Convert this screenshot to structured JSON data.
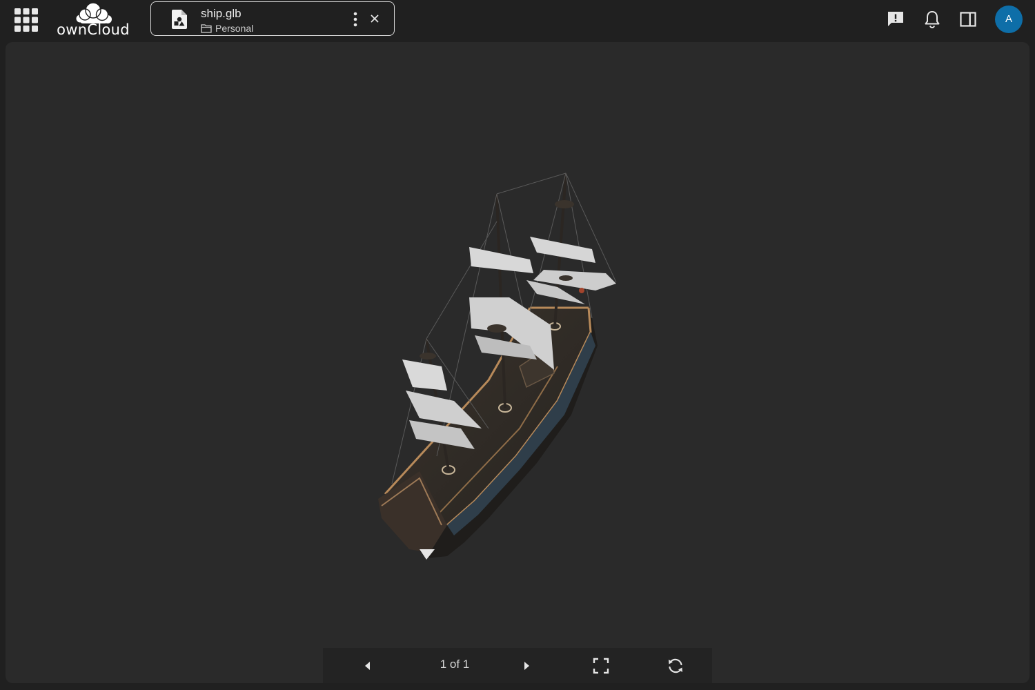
{
  "app": {
    "brand": "ownCloud"
  },
  "file": {
    "name": "ship.glb",
    "location": "Personal"
  },
  "user": {
    "avatar_initial": "A",
    "avatar_color": "#0e6ea8"
  },
  "viewer": {
    "page_indicator": "1 of 1"
  },
  "icons": {
    "app_switcher": "grid-icon",
    "file_type": "3d-model-file-icon",
    "folder": "folder-icon",
    "more": "kebab-icon",
    "close": "close-icon",
    "feedback": "feedback-icon",
    "notifications": "bell-icon",
    "sidebar": "sidebar-toggle-icon",
    "prev": "prev-icon",
    "next": "next-icon",
    "fullscreen": "fullscreen-icon",
    "reset": "reset-icon"
  },
  "colors": {
    "background": "#202020",
    "viewer": "#2a2a2a",
    "accent": "#0e6ea8"
  }
}
